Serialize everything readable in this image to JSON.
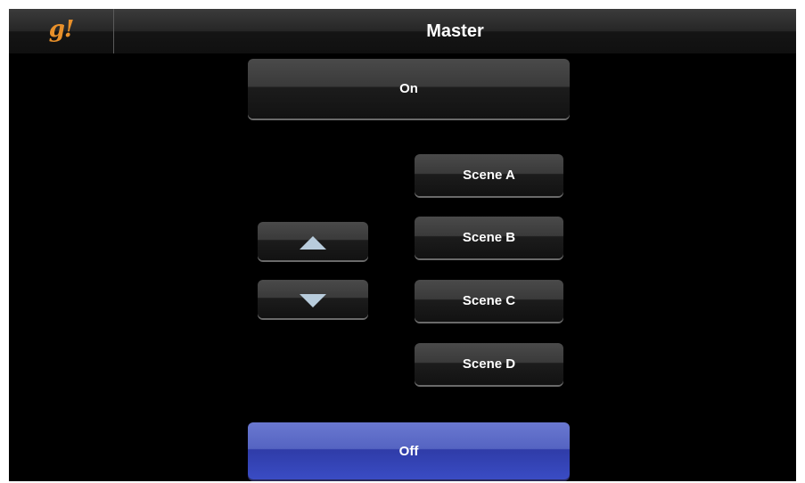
{
  "header": {
    "logo_text": "g!",
    "title": "Master"
  },
  "controls": {
    "on_label": "On",
    "off_label": "Off",
    "scenes": [
      "Scene A",
      "Scene B",
      "Scene C",
      "Scene D"
    ],
    "arrow_up_icon": "triangle-up",
    "arrow_down_icon": "triangle-down"
  },
  "colors": {
    "logo": "#e8902a",
    "off_button": "#3a4cc4",
    "arrow": "#b8ccdc"
  }
}
